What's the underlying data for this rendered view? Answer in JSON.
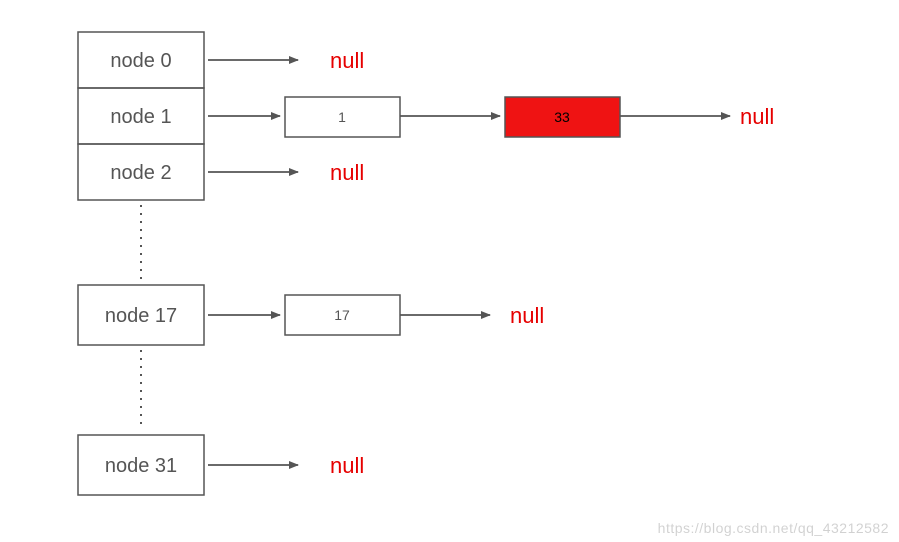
{
  "diagram": {
    "buckets": {
      "b0": "node 0",
      "b1": "node 1",
      "b2": "node 2",
      "b17": "node 17",
      "b31": "node 31"
    },
    "entries": {
      "e1": "1",
      "e33": "33",
      "e17": "17"
    },
    "null_label": "null",
    "colors": {
      "highlight_fill": "#ef1313",
      "box_stroke": "#555555",
      "arrow_stroke": "#555555",
      "null_text": "#e60000"
    }
  },
  "watermark": "https://blog.csdn.net/qq_43212582"
}
